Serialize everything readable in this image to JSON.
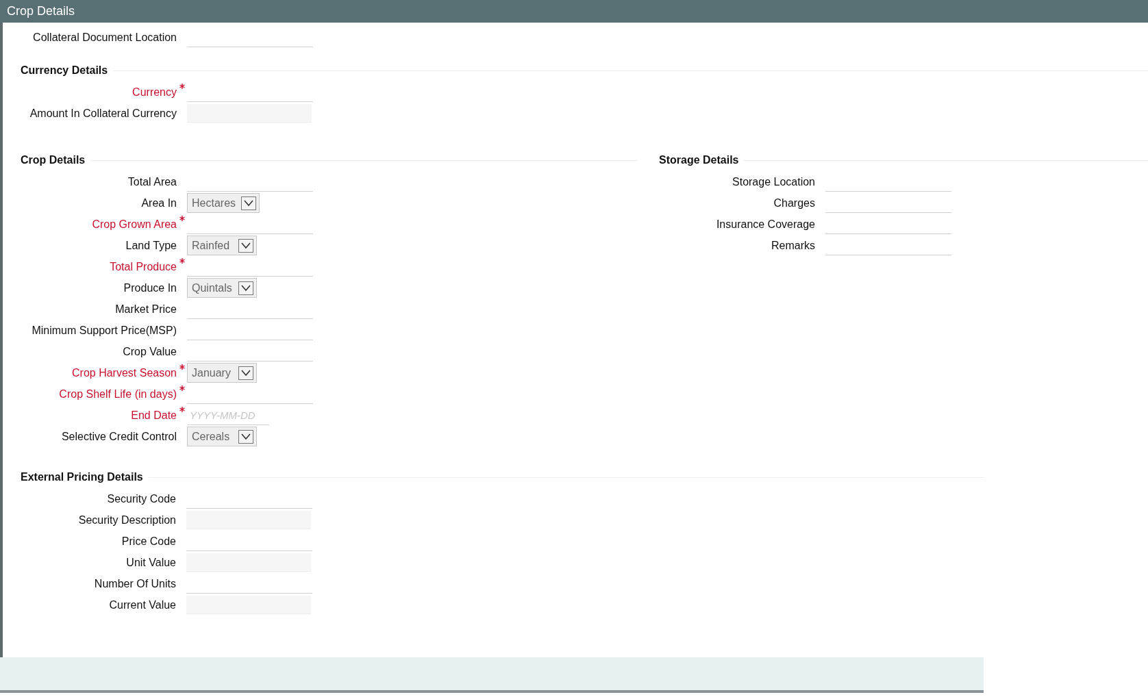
{
  "window": {
    "title": "Crop Details"
  },
  "top_fields": [
    {
      "label": "Collateral Document Location",
      "kind": "text",
      "required": false
    }
  ],
  "currency_details": {
    "title": "Currency Details",
    "fields": [
      {
        "label": "Currency",
        "kind": "text",
        "required": true
      },
      {
        "label": "Amount In Collateral Currency",
        "kind": "readonly",
        "required": false
      }
    ]
  },
  "crop_details": {
    "title": "Crop Details",
    "fields": [
      {
        "label": "Total Area",
        "kind": "text",
        "required": false
      },
      {
        "label": "Area In",
        "kind": "select",
        "required": false,
        "value": "Hectares"
      },
      {
        "label": "Crop Grown Area",
        "kind": "text",
        "required": true
      },
      {
        "label": "Land Type",
        "kind": "select",
        "required": false,
        "value": "Rainfed"
      },
      {
        "label": "Total Produce",
        "kind": "text",
        "required": true
      },
      {
        "label": "Produce In",
        "kind": "select",
        "required": false,
        "value": "Quintals"
      },
      {
        "label": "Market Price",
        "kind": "text",
        "required": false
      },
      {
        "label": "Minimum Support Price(MSP)",
        "kind": "text",
        "required": false
      },
      {
        "label": "Crop Value",
        "kind": "text",
        "required": false
      },
      {
        "label": "Crop Harvest Season",
        "kind": "select",
        "required": true,
        "value": "January"
      },
      {
        "label": "Crop Shelf Life (in days)",
        "kind": "text",
        "required": true
      },
      {
        "label": "End Date",
        "kind": "date",
        "required": true,
        "placeholder": "YYYY-MM-DD"
      },
      {
        "label": "Selective Credit Control",
        "kind": "select",
        "required": false,
        "value": "Cereals"
      }
    ]
  },
  "storage_details": {
    "title": "Storage Details",
    "fields": [
      {
        "label": "Storage Location",
        "kind": "text",
        "required": false
      },
      {
        "label": "Charges",
        "kind": "text",
        "required": false
      },
      {
        "label": "Insurance Coverage",
        "kind": "text",
        "required": false
      },
      {
        "label": "Remarks",
        "kind": "text",
        "required": false
      }
    ]
  },
  "external_pricing_details": {
    "title": "External Pricing Details",
    "fields": [
      {
        "label": "Security Code",
        "kind": "text",
        "required": false
      },
      {
        "label": "Security Description",
        "kind": "readonly",
        "required": false
      },
      {
        "label": "Price Code",
        "kind": "text",
        "required": false
      },
      {
        "label": "Unit Value",
        "kind": "readonly",
        "required": false
      },
      {
        "label": "Number Of Units",
        "kind": "text",
        "required": false
      },
      {
        "label": "Current Value",
        "kind": "readonly",
        "required": false
      }
    ]
  }
}
